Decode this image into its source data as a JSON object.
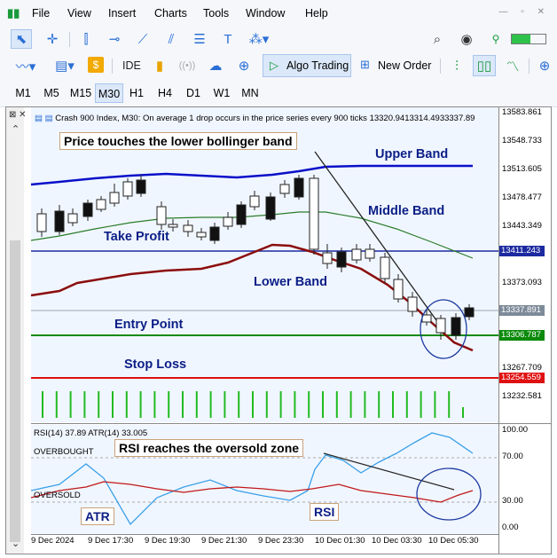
{
  "menu": {
    "items": [
      "File",
      "View",
      "Insert",
      "Charts",
      "Tools",
      "Window",
      "Help"
    ]
  },
  "toolbar2": {
    "ide": "IDE",
    "algo_trading": "Algo Trading",
    "new_order": "New Order"
  },
  "timeframes": {
    "items": [
      "M1",
      "M5",
      "M15",
      "M30",
      "H1",
      "H4",
      "D1",
      "W1",
      "MN"
    ],
    "active": "M30"
  },
  "chart": {
    "header": "Crash 900 Index, M30:  On average 1 drop occurs in the price series every 900 ticks   13320.9413314.4933337.89",
    "price_axis": [
      "13583.861",
      "13548.733",
      "13513.605",
      "13478.477",
      "13443.349",
      "13373.093",
      "13267.709",
      "13232.581"
    ],
    "price_tags": {
      "blue": "13411.243",
      "gray": "13337.891",
      "green": "13306.787",
      "red": "13254.559"
    },
    "annotations": {
      "price_touches": "Price touches the lower bollinger band",
      "upper_band": "Upper Band",
      "middle_band": "Middle Band",
      "take_profit": "Take Profit",
      "lower_band": "Lower Band",
      "entry_point": "Entry Point",
      "stop_loss": "Stop Loss",
      "rsi_zone": "RSI reaches the oversold zone",
      "atr": "ATR",
      "rsi": "RSI"
    },
    "indicator_header": "RSI(14) 37.89 ATR(14) 33.005",
    "overbought": "OVERBOUGHT",
    "oversold": "OVERSOLD",
    "rsi_axis": [
      "100.00",
      "70.00",
      "30.00",
      "0.00"
    ],
    "time_axis": [
      "9 Dec 2024",
      "9 Dec 17:30",
      "9 Dec 19:30",
      "9 Dec 21:30",
      "9 Dec 23:30",
      "10 Dec 01:30",
      "10 Dec 03:30",
      "10 Dec 05:30"
    ]
  },
  "colors": {
    "upper": "#0a10c8",
    "middle": "#2a7d2a",
    "lower": "#8b0d0d",
    "entry": "#0a8a0a",
    "stop": "#e01010",
    "tp": "#1c2aa0",
    "rsi": "#c01818",
    "atr": "#3aa0e8",
    "accent": "#2a6fd6"
  }
}
